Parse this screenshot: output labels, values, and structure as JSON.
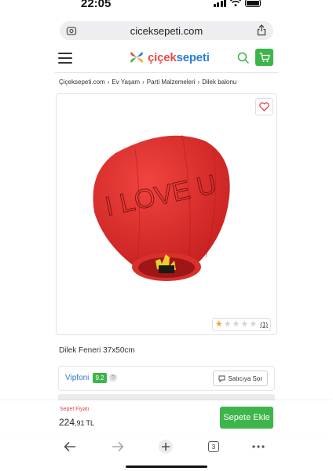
{
  "status_bar": {
    "time": "22:05"
  },
  "browser": {
    "url": "ciceksepeti.com",
    "open_tabs": "3"
  },
  "header": {
    "logo_text": "çiçeksepeti",
    "colors": {
      "logo_part1": "#e94b4b",
      "logo_part2": "#2b7fd4",
      "cart": "#3db54a"
    }
  },
  "breadcrumb": [
    "Çiçeksepeti.com",
    "Ev Yaşam",
    "Parti Malzemeleri",
    "Dilek balonu"
  ],
  "product": {
    "image_text": "I LOVE U",
    "rating": {
      "stars_filled": 1,
      "stars_total": 5,
      "count": "(1)"
    },
    "title": "Dilek Feneri 37x50cm"
  },
  "seller": {
    "name": "Vipfoni",
    "score": "9.2",
    "help": "?",
    "ask_label": "Satıcıya Sor"
  },
  "purchase": {
    "price_label": "Sepet Fiyatı",
    "price_main": "224",
    "price_decimal": ",91",
    "currency": "TL",
    "add_to_cart_label": "Sepete Ekle"
  }
}
